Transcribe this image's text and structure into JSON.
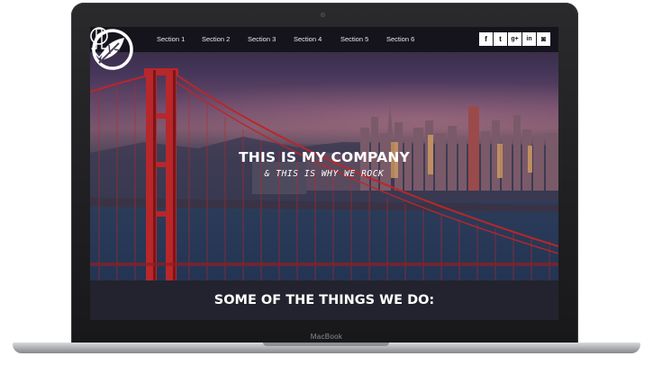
{
  "device": {
    "brand": "MacBook"
  },
  "nav": {
    "logo_icon": "leaf-circle-logo",
    "links": [
      "Section 1",
      "Section 2",
      "Section 3",
      "Section 4",
      "Section 5",
      "Section 6"
    ],
    "social": [
      {
        "icon": "facebook-icon",
        "glyph": "f"
      },
      {
        "icon": "twitter-icon",
        "glyph": "t"
      },
      {
        "icon": "google-plus-icon",
        "glyph": "g+"
      },
      {
        "icon": "linkedin-icon",
        "glyph": "in"
      },
      {
        "icon": "instagram-icon",
        "glyph": "◙"
      }
    ]
  },
  "hero": {
    "headline": "THIS IS MY COMPANY",
    "subline": "& THIS IS WHY WE ROCK",
    "arrow_icon": "down-arrow-icon"
  },
  "section": {
    "title": "SOME OF THE THINGS WE DO:"
  },
  "colors": {
    "bridge": "#b8272a",
    "nav_bg": "#12121a",
    "band_bg": "#22232e",
    "text": "#ffffff"
  }
}
